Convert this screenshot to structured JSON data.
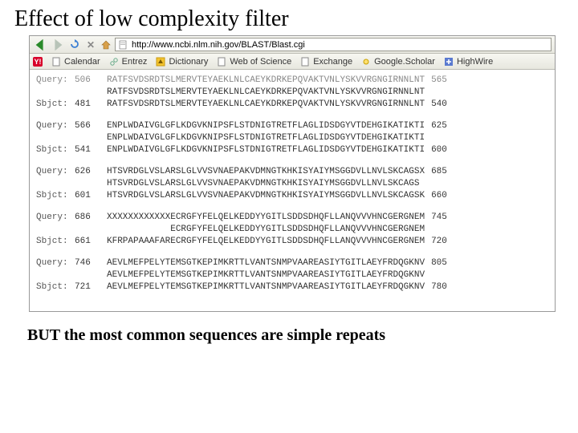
{
  "slide": {
    "title": "Effect of low complexity filter",
    "footer": "BUT the most common sequences are simple repeats"
  },
  "browser": {
    "url": "http://www.ncbi.nlm.nih.gov/BLAST/Blast.cgi",
    "bookmarks": [
      {
        "icon": "y-badge",
        "label": ""
      },
      {
        "icon": "doc-icon",
        "label": "Calendar"
      },
      {
        "icon": "link-icon",
        "label": "Entrez"
      },
      {
        "icon": "up-icon",
        "label": "Dictionary"
      },
      {
        "icon": "doc-icon",
        "label": "Web of Science"
      },
      {
        "icon": "doc-icon",
        "label": "Exchange"
      },
      {
        "icon": "sun-icon",
        "label": "Google.Scholar"
      },
      {
        "icon": "plus-icon",
        "label": "HighWire"
      }
    ]
  },
  "alignment_blocks": [
    {
      "query": {
        "label": "Query:",
        "start": "506",
        "seq": "RATFSVDSRDTSLMERVTEYAEKLNLCAEYKDRKEPQVAKTVNLYSKVVRGNGIRNNLNT",
        "end": "565"
      },
      "mid": {
        "seq": "RATFSVDSRDTSLMERVTEYAEKLNLCAEYKDRKEPQVAKTVNLYSKVVRGNGIRNNLNT"
      },
      "sbjct": {
        "label": "Sbjct:",
        "start": "481",
        "seq": "RATFSVDSRDTSLMERVTEYAEKLNLCAEYKDRKEPQVAKTVNLYSKVVRGNGIRNNLNT",
        "end": "540"
      }
    },
    {
      "query": {
        "label": "Query:",
        "start": "566",
        "seq": "ENPLWDAIVGLGFLKDGVKNIPSFLSTDNIGTRETFLAGLIDSDGYVTDEHGIKATIKTI",
        "end": "625"
      },
      "mid": {
        "seq": "ENPLWDAIVGLGFLKDGVKNIPSFLSTDNIGTRETFLAGLIDSDGYVTDEHGIKATIKTI"
      },
      "sbjct": {
        "label": "Sbjct:",
        "start": "541",
        "seq": "ENPLWDAIVGLGFLKDGVKNIPSFLSTDNIGTRETFLAGLIDSDGYVTDEHGIKATIKTI",
        "end": "600"
      }
    },
    {
      "query": {
        "label": "Query:",
        "start": "626",
        "seq": "HTSVRDGLVSLARSLGLVVSVNAEPAKVDMNGTKHKISYAIYMSGGDVLLNVLSKCAGSX",
        "end": "685"
      },
      "mid": {
        "seq": "HTSVRDGLVSLARSLGLVVSVNAEPAKVDMNGTKHKISYAIYMSGGDVLLNVLSKCAGS "
      },
      "sbjct": {
        "label": "Sbjct:",
        "start": "601",
        "seq": "HTSVRDGLVSLARSLGLVVSVNAEPAKVDMNGTKHKISYAIYMSGGDVLLNVLSKCAGSK",
        "end": "660"
      }
    },
    {
      "query": {
        "label": "Query:",
        "start": "686",
        "seq": "XXXXXXXXXXXXECRGFYFELQELKEDDYYGITLSDDSDHQFLLANQVVVHNCGERGNEM",
        "end": "745"
      },
      "mid": {
        "seq": "            ECRGFYFELQELKEDDYYGITLSDDSDHQFLLANQVVVHNCGERGNEM"
      },
      "sbjct": {
        "label": "Sbjct:",
        "start": "661",
        "seq": "KFRPAPAAAFARECRGFYFELQELKEDDYYGITLSDDSDHQFLLANQVVVHNCGERGNEM",
        "end": "720"
      }
    },
    {
      "query": {
        "label": "Query:",
        "start": "746",
        "seq": "AEVLMEFPELYTEMSGTKEPIMKRTTLVANTSNMPVAAREASIYTGITLAEYFRDQGKNV",
        "end": "805"
      },
      "mid": {
        "seq": "AEVLMEFPELYTEMSGTKEPIMKRTTLVANTSNMPVAAREASIYTGITLAEYFRDQGKNV"
      },
      "sbjct": {
        "label": "Sbjct:",
        "start": "721",
        "seq": "AEVLMEFPELYTEMSGTKEPIMKRTTLVANTSNMPVAAREASIYTGITLAEYFRDQGKNV",
        "end": "780"
      }
    }
  ]
}
